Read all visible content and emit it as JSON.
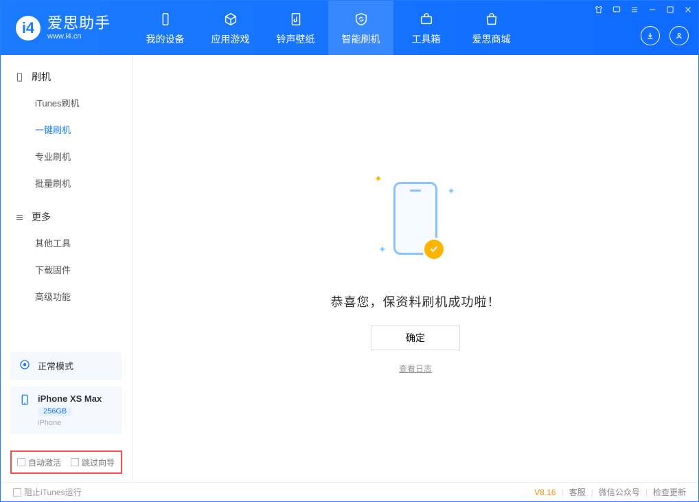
{
  "app": {
    "name": "爱思助手",
    "site": "www.i4.cn"
  },
  "nav": {
    "tabs": [
      {
        "label": "我的设备"
      },
      {
        "label": "应用游戏"
      },
      {
        "label": "铃声壁纸"
      },
      {
        "label": "智能刷机"
      },
      {
        "label": "工具箱"
      },
      {
        "label": "爱思商城"
      }
    ]
  },
  "sidebar": {
    "groups": [
      {
        "title": "刷机",
        "items": [
          {
            "label": "iTunes刷机"
          },
          {
            "label": "一键刷机",
            "selected": true
          },
          {
            "label": "专业刷机"
          },
          {
            "label": "批量刷机"
          }
        ]
      },
      {
        "title": "更多",
        "items": [
          {
            "label": "其他工具"
          },
          {
            "label": "下载固件"
          },
          {
            "label": "高级功能"
          }
        ]
      }
    ],
    "mode_card": {
      "label": "正常模式"
    },
    "device_card": {
      "name": "iPhone XS Max",
      "capacity": "256GB",
      "type": "iPhone"
    },
    "options": {
      "auto_activate": "自动激活",
      "skip_guide": "跳过向导"
    }
  },
  "main": {
    "success_text": "恭喜您，保资料刷机成功啦！",
    "ok_label": "确定",
    "log_link": "查看日志"
  },
  "footer": {
    "block_itunes": "阻止iTunes运行",
    "version": "V8.16",
    "links": {
      "kefu": "客服",
      "wechat": "微信公众号",
      "update": "检查更新"
    }
  }
}
